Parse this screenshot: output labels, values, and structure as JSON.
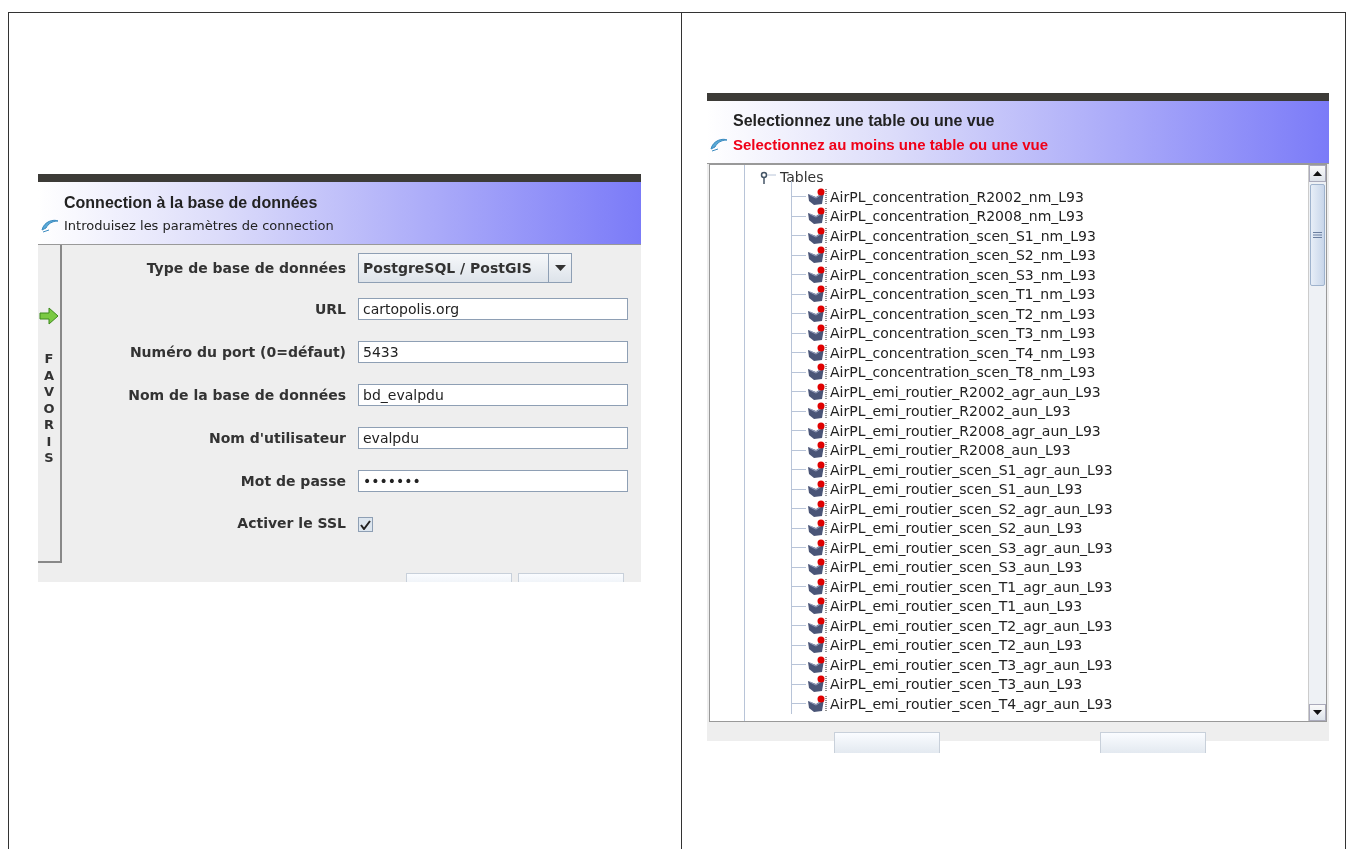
{
  "connection_dialog": {
    "title": "Connection à la base de données",
    "subtitle": "Introduisez les paramètres de connection",
    "side_tab": "FAVORIS",
    "fields": [
      {
        "kind": "dropdown",
        "label": "Type de base de données",
        "value": "PostgreSQL / PostGIS"
      },
      {
        "kind": "text",
        "label": "URL",
        "value": "cartopolis.org"
      },
      {
        "kind": "text",
        "label": "Numéro du port (0=défaut)",
        "value": "5433"
      },
      {
        "kind": "text",
        "label": "Nom de la base de données",
        "value": "bd_evalpdu"
      },
      {
        "kind": "text",
        "label": "Nom d'utilisateur",
        "value": "evalpdu"
      },
      {
        "kind": "password",
        "label": "Mot de passe",
        "value": "•••••••"
      },
      {
        "kind": "checkbox",
        "label": "Activer le SSL",
        "checked": true
      }
    ]
  },
  "table_dialog": {
    "title": "Selectionnez une table ou une vue",
    "message": "Selectionnez au moins une table ou une vue",
    "tree": [
      {
        "label": "Tables",
        "expanded": true,
        "children": [
          {
            "label": "AirPL_concentration_R2002_nm_L93"
          },
          {
            "label": "AirPL_concentration_R2008_nm_L93"
          },
          {
            "label": "AirPL_concentration_scen_S1_nm_L93"
          },
          {
            "label": "AirPL_concentration_scen_S2_nm_L93"
          },
          {
            "label": "AirPL_concentration_scen_S3_nm_L93"
          },
          {
            "label": "AirPL_concentration_scen_T1_nm_L93"
          },
          {
            "label": "AirPL_concentration_scen_T2_nm_L93"
          },
          {
            "label": "AirPL_concentration_scen_T3_nm_L93"
          },
          {
            "label": "AirPL_concentration_scen_T4_nm_L93"
          },
          {
            "label": "AirPL_concentration_scen_T8_nm_L93"
          },
          {
            "label": "AirPL_emi_routier_R2002_agr_aun_L93"
          },
          {
            "label": "AirPL_emi_routier_R2002_aun_L93"
          },
          {
            "label": "AirPL_emi_routier_R2008_agr_aun_L93"
          },
          {
            "label": "AirPL_emi_routier_R2008_aun_L93"
          },
          {
            "label": "AirPL_emi_routier_scen_S1_agr_aun_L93"
          },
          {
            "label": "AirPL_emi_routier_scen_S1_aun_L93"
          },
          {
            "label": "AirPL_emi_routier_scen_S2_agr_aun_L93"
          },
          {
            "label": "AirPL_emi_routier_scen_S2_aun_L93"
          },
          {
            "label": "AirPL_emi_routier_scen_S3_agr_aun_L93"
          },
          {
            "label": "AirPL_emi_routier_scen_S3_aun_L93"
          },
          {
            "label": "AirPL_emi_routier_scen_T1_agr_aun_L93"
          },
          {
            "label": "AirPL_emi_routier_scen_T1_aun_L93"
          },
          {
            "label": "AirPL_emi_routier_scen_T2_agr_aun_L93"
          },
          {
            "label": "AirPL_emi_routier_scen_T2_aun_L93"
          },
          {
            "label": "AirPL_emi_routier_scen_T3_agr_aun_L93"
          },
          {
            "label": "AirPL_emi_routier_scen_T3_aun_L93"
          },
          {
            "label": "AirPL_emi_routier_scen_T4_agr_aun_L93"
          }
        ]
      }
    ]
  }
}
